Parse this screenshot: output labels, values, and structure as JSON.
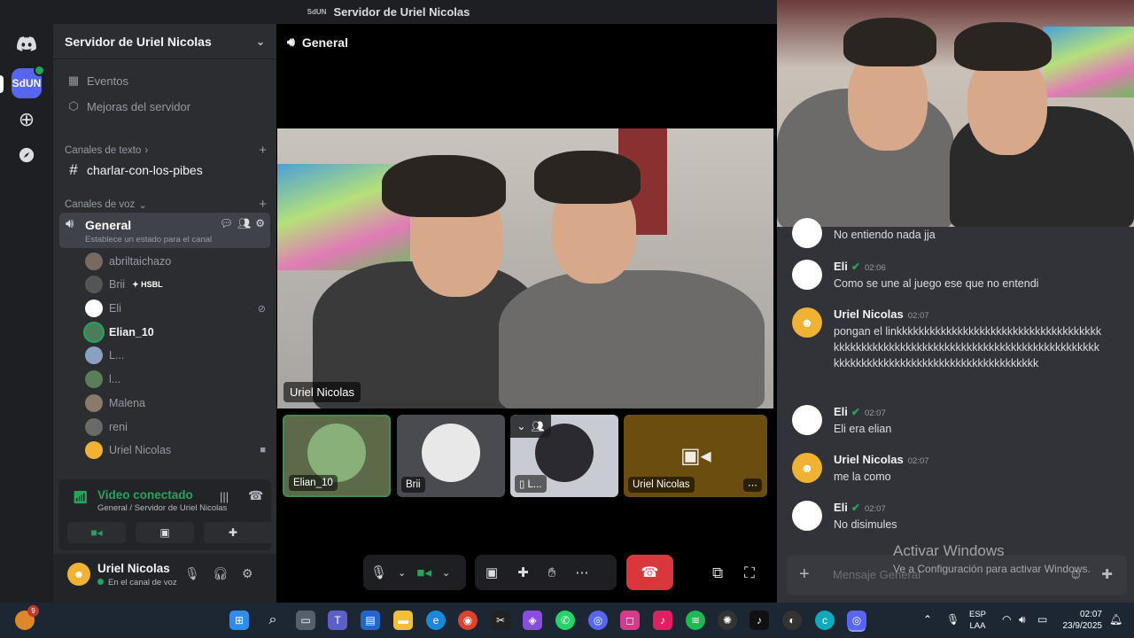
{
  "window": {
    "title": "Servidor de Uriel Nicolas",
    "title_prefix": "SdUN"
  },
  "rail": {
    "server_abbr": "SdUN"
  },
  "sidebar": {
    "server_name": "Servidor de Uriel Nicolas",
    "links": [
      {
        "label": "Eventos"
      },
      {
        "label": "Mejoras del servidor"
      }
    ],
    "text_category": "Canales de texto",
    "text_channels": [
      {
        "name": "charlar-con-los-pibes"
      }
    ],
    "voice_category": "Canales de voz",
    "voice_channel": {
      "name": "General",
      "status_placeholder": "Establece un estado para el canal"
    },
    "voice_members": [
      {
        "name": "abriltaichazo",
        "color": "#7a6a5e"
      },
      {
        "name": "Brii",
        "tag": "HSBL",
        "color": "#555"
      },
      {
        "name": "Eli",
        "color": "#ffffff"
      },
      {
        "name": "Elian_10",
        "color": "#4a7d5a"
      },
      {
        "name": "L...",
        "color": "#8aa0c0"
      },
      {
        "name": "l...",
        "color": "#5a7d5a"
      },
      {
        "name": "Malena",
        "color": "#8a7a6a"
      },
      {
        "name": "reni",
        "color": "#6a6a6a"
      },
      {
        "name": "Uriel Nicolas",
        "color": "#f0b232"
      }
    ]
  },
  "voice_panel": {
    "title": "Video conectado",
    "subtitle": "General / Servidor de Uriel Nicolas"
  },
  "user": {
    "name": "Uriel Nicolas",
    "status": "En el canal de voz"
  },
  "stage": {
    "channel_name": "General",
    "main_video_label": "Uriel Nicolas",
    "tiles": [
      {
        "label": "Elian_10"
      },
      {
        "label": "Brii"
      },
      {
        "label": "L..."
      },
      {
        "label": "Uriel Nicolas"
      }
    ]
  },
  "chat": {
    "messages": [
      {
        "author": "",
        "time": "",
        "text": "No entiendo nada jja"
      },
      {
        "author": "Eli",
        "time": "02:06",
        "text": "Como se une al juego ese que no entendi"
      },
      {
        "author": "Uriel Nicolas",
        "time": "02:07",
        "text": "pongan el linkkkkkkkkkkkkkkkkkkkkkkkkkkkkkkkkkkkkkkkkkkkkkkkkkkkkkkkkkkkkkkkkkkkkkkkkkkkkkkkkkkkkkkkkkkkkkkkkkkkkkkkkkkkkkkkkkkkkkkkkkk"
      },
      {
        "author": "Eli",
        "time": "02:07",
        "text": "Eli era elian"
      },
      {
        "author": "Uriel Nicolas",
        "time": "02:07",
        "text": "me la como"
      },
      {
        "author": "Eli",
        "time": "02:07",
        "text": "No disimules"
      }
    ],
    "input_placeholder": "Mensaje General"
  },
  "watermark": {
    "line1": "Activar Windows",
    "line2": "Ve a Configuración para activar Windows."
  },
  "taskbar": {
    "lang_line1": "ESP",
    "lang_line2": "LAA",
    "time": "02:07",
    "date": "23/9/2025",
    "widget_badge": "9"
  },
  "colors": {
    "accent": "#5865f2",
    "online": "#23a55a",
    "danger": "#da373c"
  }
}
